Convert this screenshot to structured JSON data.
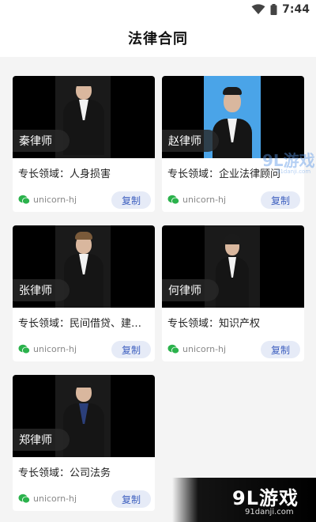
{
  "status_bar": {
    "time": "7:44",
    "icons": [
      "wifi-icon",
      "battery-icon"
    ]
  },
  "header": {
    "title": "法律合同"
  },
  "lawyers": [
    {
      "name": "秦律师",
      "specialty": "专长领域：人身损害",
      "contact": "unicorn-hj",
      "copy_label": "复制",
      "photo_bg": "dark"
    },
    {
      "name": "赵律师",
      "specialty": "专长领域：企业法律顾问",
      "contact": "unicorn-hj",
      "copy_label": "复制",
      "photo_bg": "blue"
    },
    {
      "name": "张律师",
      "specialty": "专长领域：民间借贷、建…",
      "contact": "unicorn-hj",
      "copy_label": "复制",
      "photo_bg": "dark"
    },
    {
      "name": "何律师",
      "specialty": "专长领域：知识产权",
      "contact": "unicorn-hj",
      "copy_label": "复制",
      "photo_bg": "dark"
    },
    {
      "name": "郑律师",
      "specialty": "专长领域：公司法务",
      "contact": "unicorn-hj",
      "copy_label": "复制",
      "photo_bg": "dark"
    }
  ],
  "watermark": {
    "logo": "9L游戏",
    "domain": "91danji.com"
  },
  "colors": {
    "accent": "#3d5fbf",
    "button_bg": "#e6ebf7",
    "wechat_green": "#2bb24c"
  }
}
